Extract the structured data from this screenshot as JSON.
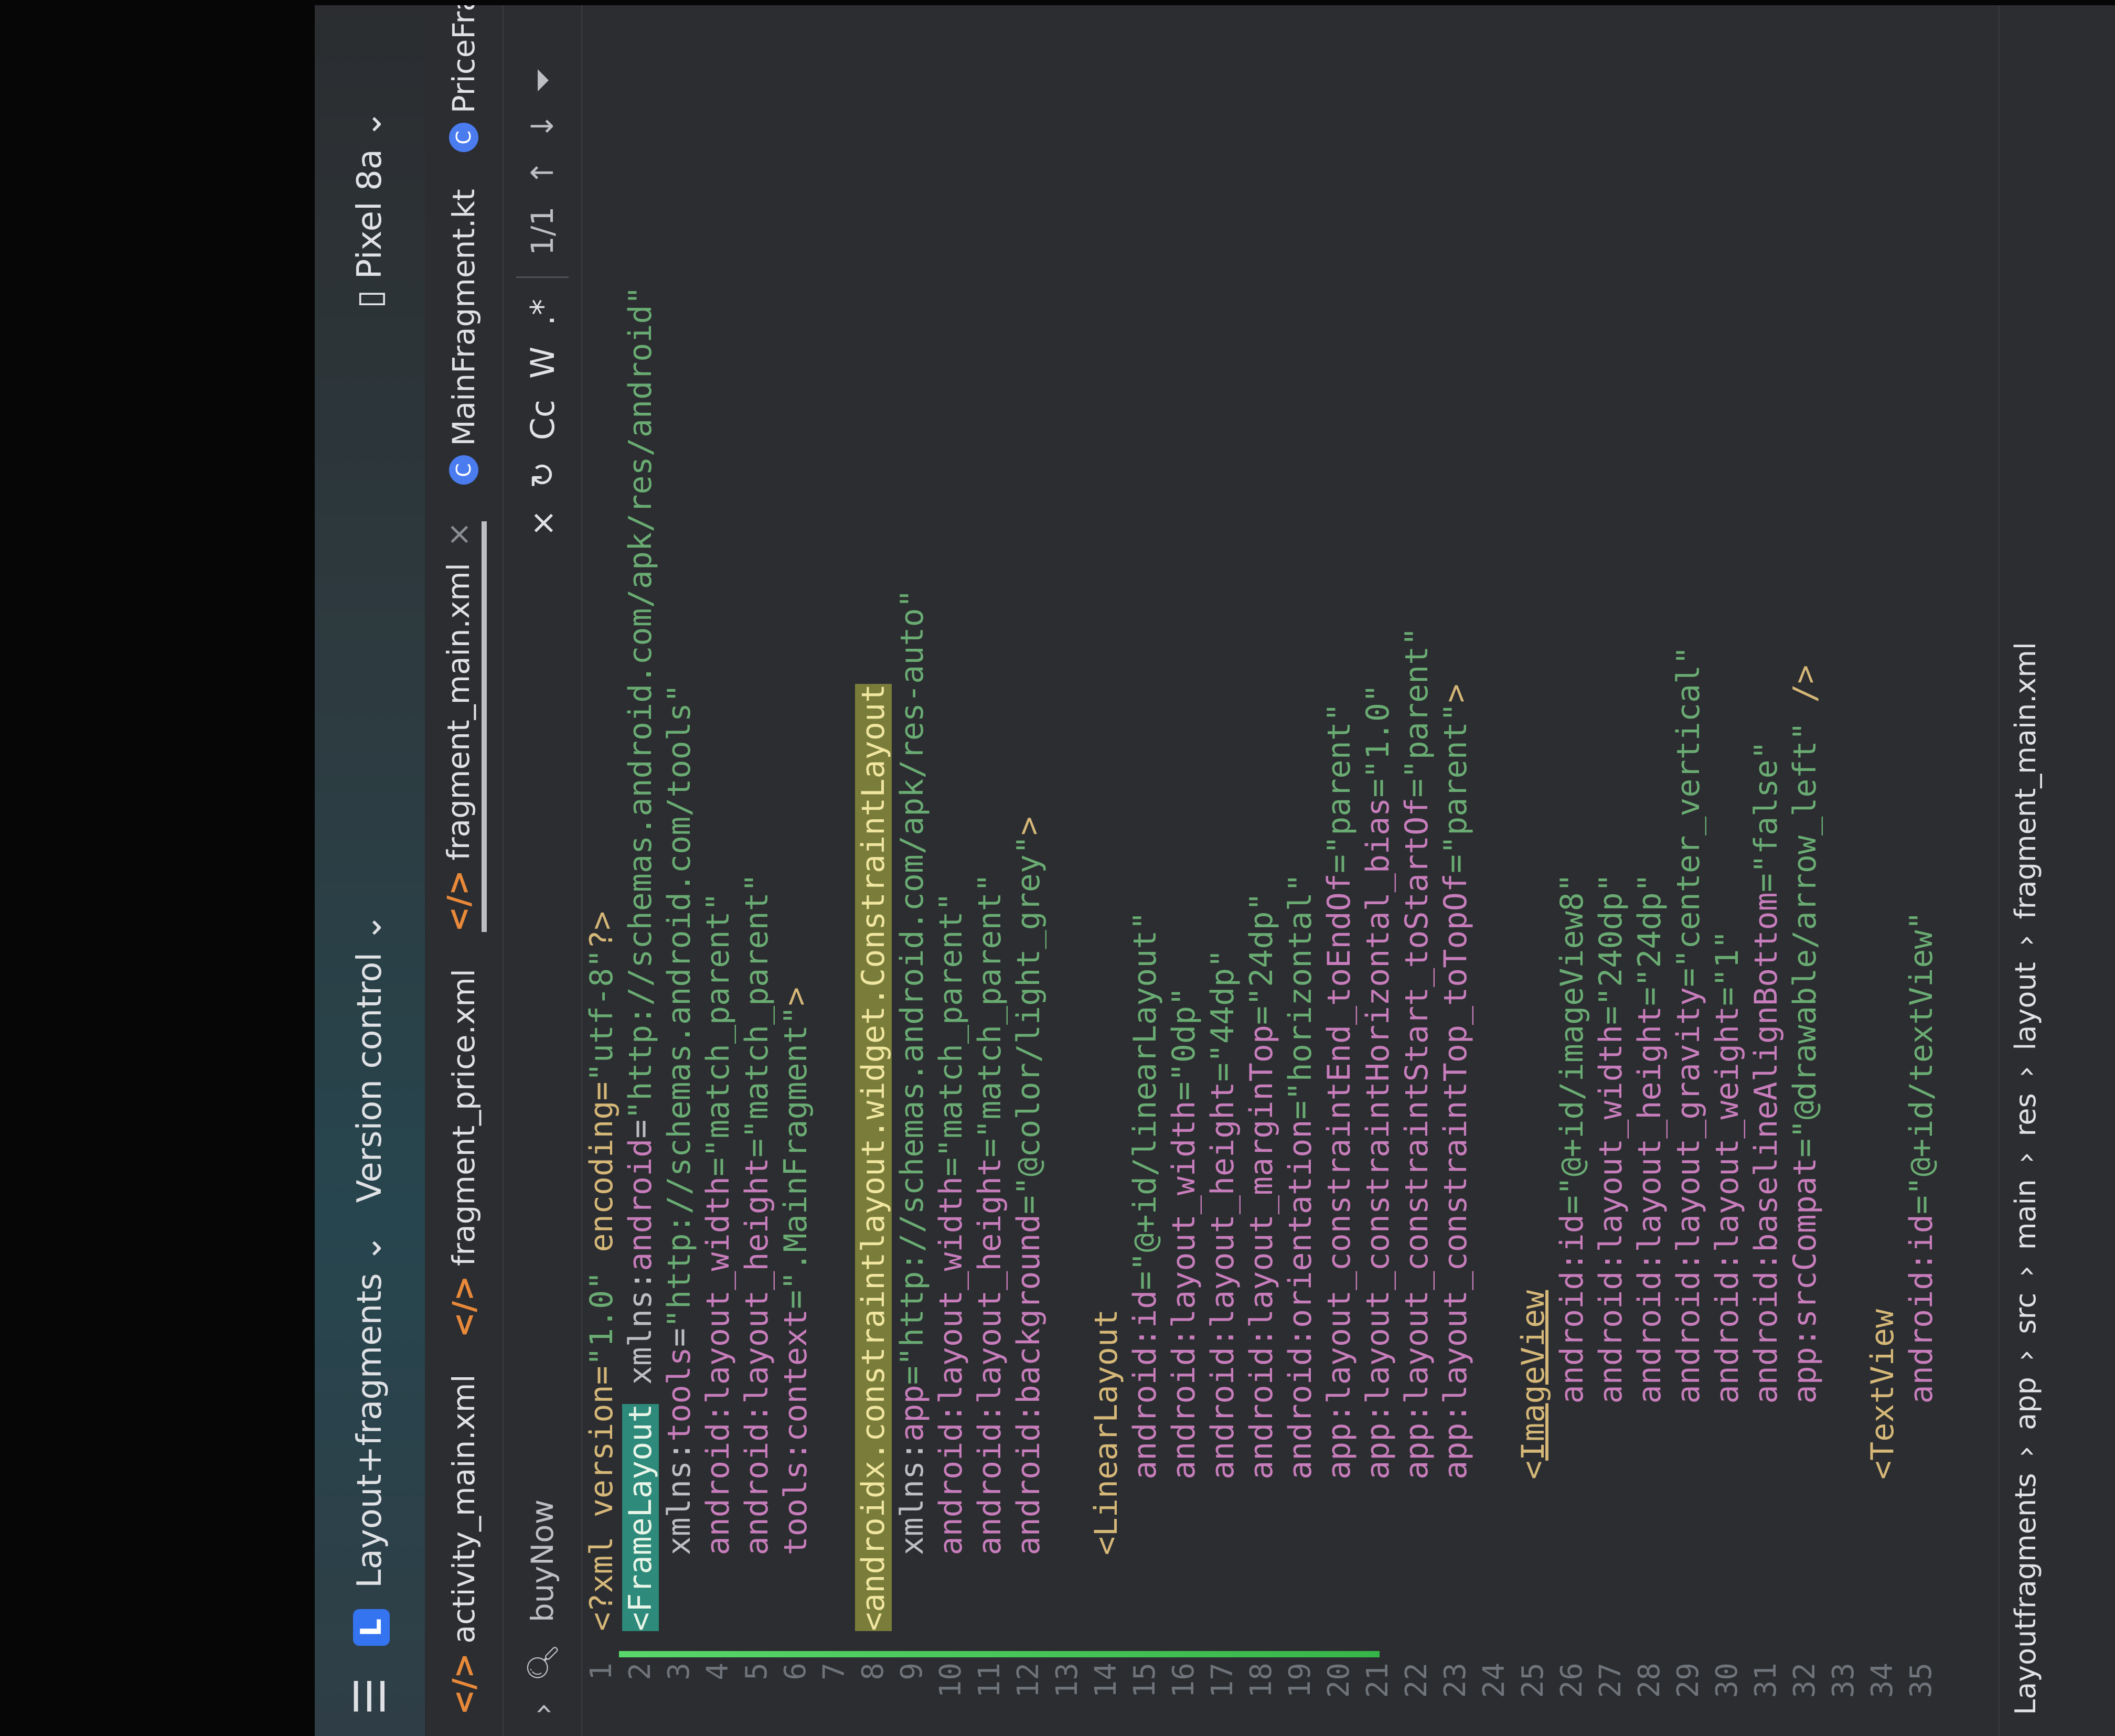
{
  "titlebar": {
    "project_badge": "L",
    "project": "Layout+fragments",
    "vcs": "Version control",
    "device": "Pixel 8a"
  },
  "tabs": [
    {
      "label": "activity_main.xml",
      "icon": "xml-icon"
    },
    {
      "label": "fragment_price.xml",
      "icon": "xml-icon"
    },
    {
      "label": "fragment_main.xml",
      "icon": "xml-icon",
      "close": "×"
    },
    {
      "label": "MainFragment.kt",
      "icon": "kotlin-icon"
    },
    {
      "label": "PriceFrag",
      "icon": "kotlin-icon"
    }
  ],
  "search": {
    "query": "buyNow",
    "match_count": "1/1",
    "case_toggle": "Cc",
    "word_toggle": "W",
    "regex_toggle": ".*",
    "close": "×"
  },
  "code": {
    "line_numbers": [
      "1",
      "2",
      "3",
      "4",
      "5",
      "6",
      "7",
      "8",
      "9",
      "10",
      "11",
      "12",
      "13",
      "14",
      "15",
      "16",
      "17",
      "18",
      "19",
      "20",
      "21",
      "22",
      "23",
      "24",
      "25",
      "26",
      "27",
      "28",
      "29",
      "30",
      "31",
      "32",
      "33",
      "34",
      "35"
    ],
    "lines": {
      "l1a": "<?xml version=",
      "l1b": "\"1.0\"",
      "l1c": " encoding=",
      "l1d": "\"utf-8\"",
      "l1e": "?>",
      "l2a": "<",
      "l2b": "FrameLayout",
      "l2c": " xmlns:",
      "l2d": "android",
      "l2e": "=",
      "l2f": "\"http://schemas.android.com/apk/res/android\"",
      "l3a": "    xmlns:",
      "l3b": "tools",
      "l3c": "=",
      "l3d": "\"http://schemas.android.com/tools\"",
      "l4a": "    android:layout_width",
      "l4b": "=\"match_parent\"",
      "l5a": "    android:layout_height",
      "l5b": "=\"match_parent\"",
      "l6a": "    tools:context",
      "l6b": "=\".MainFragment\"",
      "l6c": ">",
      "l8a": "<",
      "l8b": "androidx.constraintlayout.widget.ConstraintLayout",
      "l9a": "    xmlns:",
      "l9b": "app",
      "l9c": "=\"http://schemas.android.com/apk/res-auto\"",
      "l10a": "    android:layout_width",
      "l10b": "=\"match_parent\"",
      "l11a": "    android:layout_height",
      "l11b": "=\"match_parent\"",
      "l12a": "    android:background",
      "l12b": "=\"@color/light_grey\"",
      "l12c": ">",
      "l14": "    <LinearLayout",
      "l15a": "        android:id",
      "l15b": "=\"@+id/linearLayout\"",
      "l16a": "        android:layout_width",
      "l16b": "=\"0dp\"",
      "l17a": "        android:layout_height",
      "l17b": "=\"44dp\"",
      "l18a": "        android:layout_marginTop",
      "l18b": "=\"24dp\"",
      "l19a": "        android:orientation",
      "l19b": "=\"horizontal\"",
      "l20a": "        app:layout_constraintEnd_toEndOf",
      "l20b": "=\"parent\"",
      "l21a": "        app:layout_constraintHorizontal_bias",
      "l21b": "=\"1.0\"",
      "l22a": "        app:layout_constraintStart_toStartOf",
      "l22b": "=\"parent\"",
      "l23a": "        app:layout_constraintTop_toTopOf",
      "l23b": "=\"parent\"",
      "l23c": ">",
      "l25a": "        <",
      "l25b": "ImageView",
      "l26a": "            android:id",
      "l26b": "=\"@+id/imageView8\"",
      "l27a": "            android:layout_width",
      "l27b": "=\"240dp\"",
      "l28a": "            android:layout_height",
      "l28b": "=\"24dp\"",
      "l29a": "            android:layout_gravity",
      "l29b": "=\"center_vertical\"",
      "l30a": "            android:layout_weight",
      "l30b": "=\"1\"",
      "l31a": "            android:baselineAlignBottom",
      "l31b": "=\"false\"",
      "l32a": "            app:srcCompat",
      "l32b": "=\"@drawable/arrow_left\"",
      "l32c": " />",
      "l34": "        <TextView",
      "l35a": "            android:id",
      "l35b": "=\"@+id/textView\""
    }
  },
  "breadcrumb": [
    "Layoutfragments",
    "app",
    "src",
    "main",
    "res",
    "layout",
    "fragment_main.xml"
  ],
  "colors": {
    "editor_bg": "#2b2d30",
    "tag": "#d5b778",
    "attr": "#c77dbb",
    "value": "#6aab73",
    "accent": "#3574f0"
  }
}
